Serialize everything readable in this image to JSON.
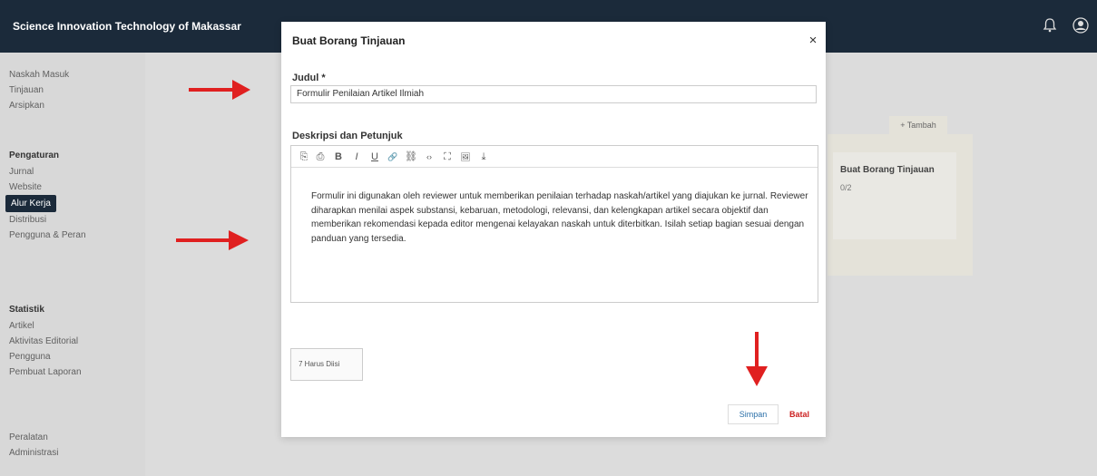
{
  "topbar": {
    "app_title": "Science Innovation Technology of Makassar"
  },
  "sidebar": {
    "group1": [
      "Naskah Masuk",
      "Tinjauan",
      "Arsipkan"
    ],
    "settings_heading": "Pengaturan",
    "settings_items": [
      "Jurnal",
      "Website",
      "Alur Kerja",
      "Distribusi",
      "Pengguna & Peran"
    ],
    "active_item": "Alur Kerja",
    "stats_heading": "Statistik",
    "stats_items": [
      "Artikel",
      "Aktivitas Editorial",
      "Pengguna",
      "Pembuat Laporan"
    ],
    "tools_items": [
      "Peralatan",
      "Administrasi"
    ]
  },
  "background": {
    "add_button": "+ Tambah",
    "card_title": "Buat Borang Tinjauan",
    "card_sub": "0/2"
  },
  "modal": {
    "title": "Buat Borang Tinjauan",
    "close_glyph": "×",
    "judul_label": "Judul *",
    "judul_value": "Formulir Penilaian Artikel Ilmiah",
    "desc_label": "Deskripsi dan Petunjuk",
    "toolbar_glyphs": [
      "⎘",
      "⎙",
      "B",
      "I",
      "U",
      "🔗",
      "⛓",
      "‹›",
      "⛶",
      "🖼",
      "⤓"
    ],
    "description_text": "Formulir ini digunakan oleh reviewer untuk memberikan penilaian terhadap naskah/artikel yang diajukan ke jurnal. Reviewer diharapkan menilai aspek substansi, kebaruan, metodologi, relevansi, dan kelengkapan artikel secara objektif dan memberikan rekomendasi kepada editor mengenai kelayakan naskah untuk diterbitkan. Isilah setiap bagian sesuai dengan panduan yang tersedia.",
    "word_count": "7 Harus Diisi",
    "save_label": "Simpan",
    "cancel_label": "Batal"
  },
  "colors": {
    "topbar": "#1b2a3a",
    "arrow": "#e02020",
    "cancel": "#cc2222",
    "save": "#2a6fa8"
  }
}
